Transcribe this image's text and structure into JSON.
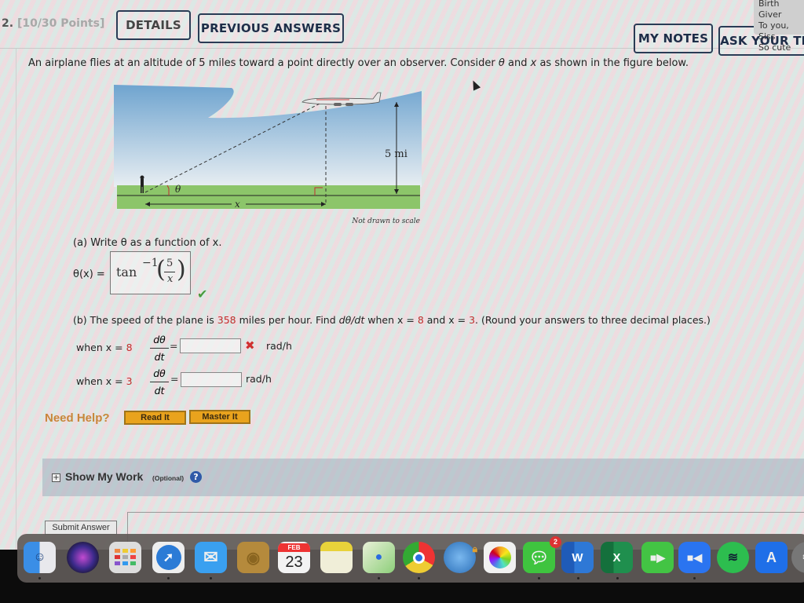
{
  "header": {
    "question_number": "2.",
    "points": "[10/30 Points]",
    "details_label": "DETAILS",
    "previous_answers_label": "PREVIOUS ANSWERS",
    "my_notes_label": "MY NOTES",
    "ask_teacher_label": "ASK YOUR TEA"
  },
  "notification": {
    "title": "Birth Giver",
    "line1": "To you, Siss",
    "line2": "So cute"
  },
  "problem": {
    "prompt_pre": "An airplane flies at an altitude of 5 miles toward a point directly over an observer. Consider ",
    "theta": "θ",
    "prompt_mid": " and ",
    "x": "x",
    "prompt_post": " as shown in the figure below."
  },
  "figure": {
    "altitude_label": "5 mi",
    "theta_label": "θ",
    "x_label": "x",
    "caption": "Not drawn to scale"
  },
  "part_a": {
    "label": "(a) Write θ as a function of x.",
    "lhs": "θ(x) =",
    "answer_func": "tan",
    "answer_exp": "−1",
    "answer_num": "5",
    "answer_den": "x",
    "status": "correct",
    "check_icon": "✔"
  },
  "part_b": {
    "label_pre": "(b) The speed of the plane is ",
    "speed": "358",
    "label_mid1": " miles per hour. Find ",
    "derivative": "dθ/dt",
    "label_mid2": " when x = ",
    "x1": "8",
    "label_mid3": " and x = ",
    "x2": "3",
    "label_post": ". (Round your answers to three decimal places.)",
    "rows": [
      {
        "when": "when x = ",
        "x": "8",
        "num": "dθ",
        "den": "dt",
        "eq": "=",
        "value": "",
        "status": "incorrect",
        "mark": "✖",
        "unit": "rad/h"
      },
      {
        "when": "when x = ",
        "x": "3",
        "num": "dθ",
        "den": "dt",
        "eq": "=",
        "value": "",
        "status": "",
        "mark": "",
        "unit": "rad/h"
      }
    ]
  },
  "help": {
    "label": "Need Help?",
    "read_it": "Read It",
    "master_it": "Master It"
  },
  "show_my_work": {
    "expand": "+",
    "title": "Show My Work",
    "optional": "(Optional)",
    "help_icon": "?"
  },
  "submit_label": "Submit Answer",
  "dock": {
    "calendar_month": "FEB",
    "calendar_day": "23",
    "messages_badge": "2",
    "word_letter": "W",
    "excel_letter": "X"
  },
  "colors": {
    "accent_red": "#c42b2b",
    "correct_green": "#4a9a3c",
    "help_orange": "#e9a31d",
    "button_border": "#2a3b55"
  }
}
